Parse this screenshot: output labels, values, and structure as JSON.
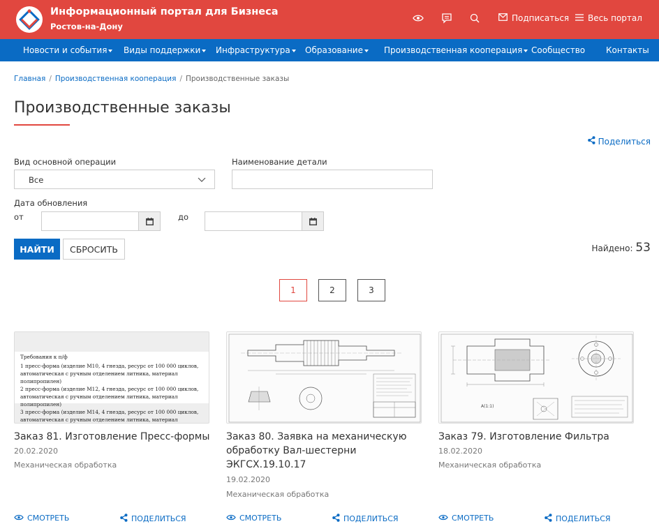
{
  "header": {
    "title": "Информационный портал для Бизнеса",
    "subtitle": "Ростов-на-Дону",
    "subscribe_label": "Подписаться",
    "all_portal_label": "Весь портал"
  },
  "nav": {
    "items": [
      {
        "label": "Новости и события",
        "dropdown": true
      },
      {
        "label": "Виды поддержки",
        "dropdown": true
      },
      {
        "label": "Инфраструктура",
        "dropdown": true
      },
      {
        "label": "Образование",
        "dropdown": true
      },
      {
        "label": "Производственная кооперация",
        "dropdown": true
      },
      {
        "label": "Сообщество",
        "dropdown": false
      },
      {
        "label": "Контакты",
        "dropdown": false
      }
    ]
  },
  "breadcrumb": {
    "home": "Главная",
    "parent": "Производственная кооперация",
    "current": "Производственные заказы",
    "separator": "/"
  },
  "page": {
    "title": "Производственные заказы",
    "share_label": "Поделиться"
  },
  "filters": {
    "operation_label": "Вид основной операции",
    "operation_value": "Все",
    "part_name_label": "Наименование детали",
    "part_name_value": "",
    "date_label": "Дата обновления",
    "from_label": "от",
    "to_label": "до",
    "from_value": "",
    "to_value": ""
  },
  "actions": {
    "find_label": "НАЙТИ",
    "reset_label": "СБРОСИТЬ"
  },
  "results": {
    "found_label": "Найдено:",
    "found_count": "53"
  },
  "pagination": {
    "pages": [
      "1",
      "2",
      "3"
    ],
    "current": "1"
  },
  "cards": [
    {
      "title": "Заказ 81. Изготовление Пресс-формы",
      "date": "20.02.2020",
      "category": "Механическая обработка",
      "image_text": [
        "Требования к п/ф",
        "1 пресс-форма (изделие М10, 4 гнезда, ресурс от 100 000 циклов,",
        "автоматическая с ручным отделением литника, материал полипропилен)",
        "2 пресс-форма (изделие М12, 4 гнезда, ресурс от 100 000 циклов,",
        "автоматическая с ручным отделением литника, материал полипропилен)",
        "3 пресс-форма (изделие М14, 4 гнезда, ресурс от 100 000 циклов,",
        "автоматическая с ручным отделением литника, материал полипропилен)"
      ],
      "view_label": "СМОТРЕТЬ",
      "share_label": "ПОДЕЛИТЬСЯ"
    },
    {
      "title": "Заказ 80. Заявка на механическую обработку Вал-шестерни ЭКГСХ.19.10.17",
      "date": "19.02.2020",
      "category": "Механическая обработка",
      "view_label": "СМОТРЕТЬ",
      "share_label": "ПОДЕЛИТЬСЯ"
    },
    {
      "title": "Заказ 79. Изготовление Фильтра",
      "date": "18.02.2020",
      "category": "Механическая обработка",
      "view_label": "СМОТРЕТЬ",
      "share_label": "ПОДЕЛИТЬСЯ"
    }
  ],
  "colors": {
    "header_red": "#e1473f",
    "nav_blue": "#0a6bc4",
    "link_blue": "#0a6bc4"
  },
  "icons": {
    "logo": "portal-logo-icon",
    "accessibility": "eye-icon",
    "feedback": "chat-icon",
    "search": "search-icon",
    "subscribe": "envelope-icon",
    "all_portal": "menu-icon",
    "share": "share-icon",
    "calendar": "calendar-icon",
    "dropdown": "chevron-down-icon",
    "view": "eye-icon"
  }
}
